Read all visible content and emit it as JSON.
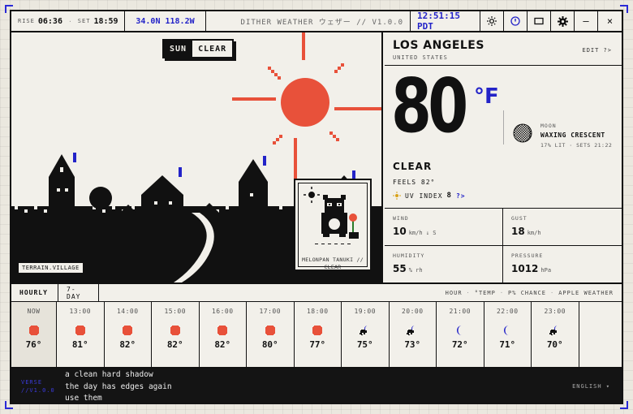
{
  "topbar": {
    "rise_label": "RISE",
    "rise_time": "06:36",
    "sep": "·",
    "set_label": "SET",
    "set_time": "18:59",
    "coords": "34.0N 118.2W",
    "app_title": "DITHER WEATHER ウェザー // V1.0.0",
    "clock": "12:51:15 PDT",
    "icons": [
      "sun-icon",
      "info-icon",
      "window-icon",
      "gear-icon",
      "minimize-icon",
      "close-icon"
    ],
    "minimize_glyph": "–",
    "close_glyph": "×"
  },
  "scene": {
    "toggle_left": "SUN",
    "toggle_right": "CLEAR",
    "terrain_label": "TERRAIN.VILLAGE",
    "card_caption_1": "MELONPAN TANUKI //",
    "card_caption_2": "CLEAR"
  },
  "location": {
    "city": "LOS ANGELES",
    "country": "UNITED STATES",
    "edit": "EDIT ?>"
  },
  "current": {
    "temp": "80",
    "unit": "°F",
    "condition": "CLEAR",
    "feels": "FEELS 82°",
    "uv_label": "UV INDEX",
    "uv_value": "8",
    "uv_link": "?>"
  },
  "moon": {
    "label": "MOON",
    "phase": "WAXING CRESCENT",
    "detail": "17% LIT · SETS 21:22"
  },
  "stats": {
    "wind_label": "WIND",
    "wind_value": "10",
    "wind_unit": "km/h ↓ S",
    "gust_label": "GUST",
    "gust_value": "18",
    "gust_unit": "km/h",
    "humidity_label": "HUMIDITY",
    "humidity_value": "55",
    "humidity_unit": "% rh",
    "pressure_label": "PRESSURE",
    "pressure_value": "1012",
    "pressure_unit": "hPa"
  },
  "tabs": {
    "hourly": "HOURLY",
    "seven_day": "7-DAY",
    "legend": [
      "HOUR",
      "°TEMP",
      "P% CHANCE",
      "APPLE WEATHER"
    ],
    "legend_sep": "·"
  },
  "hourly": [
    {
      "time": "NOW",
      "temp": "76°",
      "icon": "sun"
    },
    {
      "time": "13:00",
      "temp": "81°",
      "icon": "sun"
    },
    {
      "time": "14:00",
      "temp": "82°",
      "icon": "sun"
    },
    {
      "time": "15:00",
      "temp": "82°",
      "icon": "sun"
    },
    {
      "time": "16:00",
      "temp": "82°",
      "icon": "sun"
    },
    {
      "time": "17:00",
      "temp": "80°",
      "icon": "sun"
    },
    {
      "time": "18:00",
      "temp": "77°",
      "icon": "sun"
    },
    {
      "time": "19:00",
      "temp": "75°",
      "icon": "moon-cloud"
    },
    {
      "time": "20:00",
      "temp": "73°",
      "icon": "moon-cloud"
    },
    {
      "time": "21:00",
      "temp": "72°",
      "icon": "moon"
    },
    {
      "time": "22:00",
      "temp": "71°",
      "icon": "moon"
    },
    {
      "time": "23:00",
      "temp": "70°",
      "icon": "moon-cloud"
    }
  ],
  "footer": {
    "verse_tag_1": "VERSE",
    "verse_tag_2": "//V1.0.0",
    "poem": [
      "a clean hard shadow",
      "the day has edges again",
      "use them"
    ],
    "language": "ENGLISH ▾"
  },
  "colors": {
    "accent_blue": "#2323c8",
    "sun_red": "#e8513a",
    "ink": "#111111",
    "paper": "#f2f0ea"
  }
}
